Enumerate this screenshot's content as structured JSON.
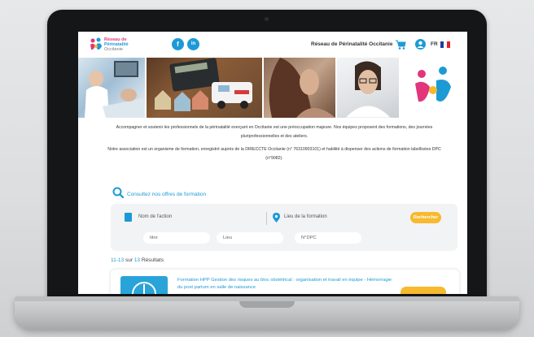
{
  "header": {
    "logo": {
      "line1": "Réseau de",
      "line2": "Périnatalité",
      "line3": "Occitanie"
    },
    "social": [
      {
        "label": "f"
      },
      {
        "label": "in"
      }
    ],
    "site_title": "Réseau de Périnatalité Occitanie",
    "lang": "FR"
  },
  "intro": {
    "p1": "Accompagner et soutenir les professionnels de la périnatalité exerçant en Occitanie est une préoccupation majeure. Nos équipes proposent des formations, des journées pluriprofessionnelles et des ateliers.",
    "p2": "Notre association est un organisme de formation, enregistré auprès de la DIRECCTE Occitanie (n° 76310903101) et habilité à dispenser des actions de formation labellisées DPC (n°9082)."
  },
  "search": {
    "heading": "Consultez nos offres de formation",
    "action_placeholder": "Nom de l'action",
    "location_placeholder": "Lieu de la formation",
    "submit": "Rechercher",
    "filters": {
      "title": "titre",
      "place": "Lieu",
      "dpc": "N°DPC"
    }
  },
  "results": {
    "range": "11-13",
    "sur": "sur",
    "total": "13",
    "label": "Résultats"
  },
  "card": {
    "title": "Formation HPP Gestion des risques au bloc obstétrical : organisation et travail en équipe - Hémorragie du post partum en salle de naissance"
  },
  "colors": {
    "brand_blue": "#1c9ad6",
    "brand_pink": "#e2357b",
    "accent_yellow": "#f7b92d"
  }
}
